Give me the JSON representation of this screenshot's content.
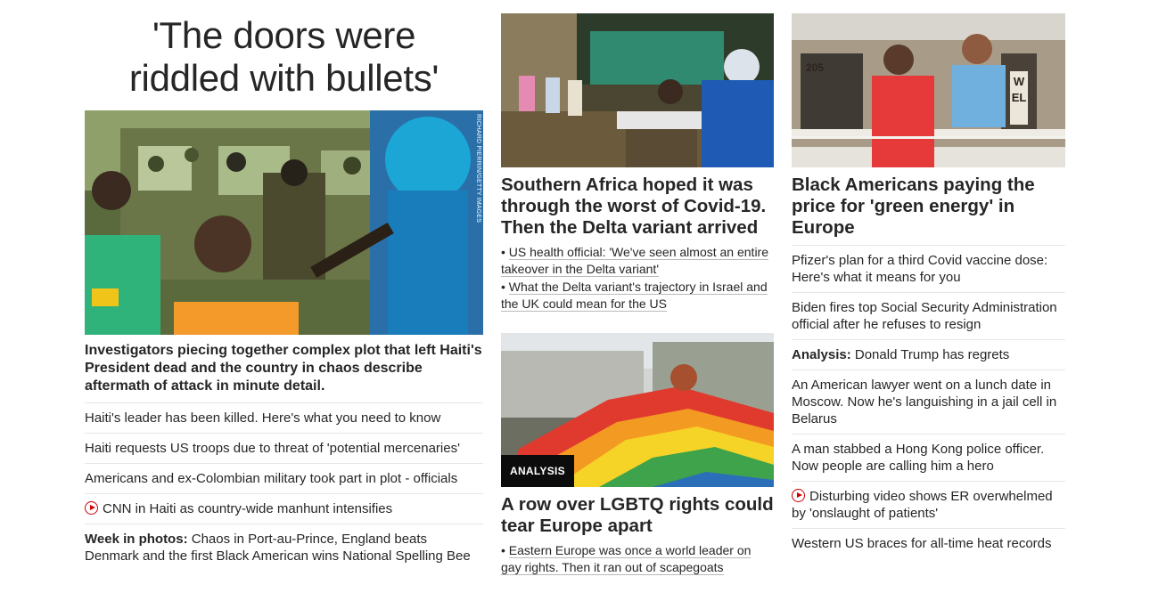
{
  "col1": {
    "headline_line1": "'The doors were",
    "headline_line2": "riddled with bullets'",
    "photo_credit": "RICHARD PIERRIN/GETTY IMAGES",
    "lead": "Investigators piecing together complex plot that left Haiti's President dead and the country in chaos describe aftermath of attack in minute detail.",
    "links": [
      "Haiti's leader has been killed. Here's what you need to know",
      "Haiti requests US troops due to threat of 'potential mercenaries'",
      "Americans and ex-Colombian military took part in plot - officials",
      "CNN in Haiti as country-wide manhunt intensifies"
    ],
    "photos_prefix": "Week in photos:",
    "photos_text": " Chaos in Port-au-Prince, England beats Denmark and the first Black American wins National Spelling Bee"
  },
  "col2": {
    "story1_title": "Southern Africa hoped it was through the worst of Covid-19. Then the Delta variant arrived",
    "story1_subs": [
      "US health official: 'We've seen almost an entire takeover in the Delta variant'",
      "What the Delta variant's trajectory in Israel and the UK could mean for the US"
    ],
    "badge": "ANALYSIS",
    "story2_title": "A row over LGBTQ rights could tear Europe apart",
    "story2_subs": [
      "Eastern Europe was once a world leader on gay rights. Then it ran out of scapegoats"
    ]
  },
  "col3": {
    "sign_number": "205",
    "sign_letters": "WEL",
    "story_title": "Black Americans paying the price for 'green energy' in Europe",
    "links": [
      "Pfizer's plan for a third Covid vaccine dose: Here's what it means for you",
      "Biden fires top Social Security Administration official after he refuses to resign"
    ],
    "analysis_prefix": "Analysis:",
    "analysis_text": " Donald Trump has regrets",
    "links2": [
      "An American lawyer went on a lunch date in Moscow. Now he's languishing in a jail cell in Belarus",
      "A man stabbed a Hong Kong police officer. Now people are calling him a hero",
      "Disturbing video shows ER overwhelmed by 'onslaught of patients'",
      "Western US braces for all-time heat records"
    ]
  }
}
